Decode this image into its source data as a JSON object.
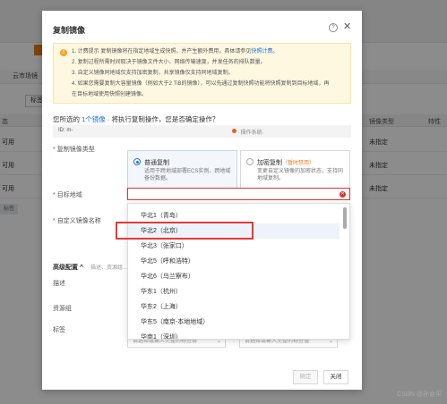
{
  "background": {
    "tabs": [
      "云市场镜",
      "标签"
    ],
    "buttons": [
      "标签"
    ],
    "table_headers": [
      "态",
      "镜像类型",
      "特性"
    ],
    "rows": [
      {
        "status": "可用",
        "type": "未指定"
      },
      {
        "status": "可用",
        "type": "未指定"
      },
      {
        "status": "可用",
        "type": "未指定"
      }
    ],
    "side_label": "标签"
  },
  "dialog": {
    "title": "复制镜像",
    "help_icon": "?",
    "close_icon": "✕",
    "notice": {
      "icon": "!",
      "line1_prefix": "1. 计费提示 复制镜像将在指定地域生成快照，并产生额外费用，具体请参见",
      "line1_link": "快照计费",
      "line1_suffix": "。",
      "line2": "2. 复制过程所需时间取决于镜像文件大小、网络传输速度，并发任务的排队数量。",
      "line3": "3. 自定义镜像同地域仅支持加密复制，共享镜像仅支持同地域复制。",
      "line4": "4. 如果您需要复制大容量镜像（例如大于2 TiB的镜像），可以先通过复制快照功能将快照复制到目标地域，再",
      "line5": "在目标地域使用快照创建镜像。"
    },
    "confirm": {
      "prefix": "您所选的 ",
      "link": "1个镜像",
      "suffix": " · 将执行复制操作，您是否确定操作？"
    },
    "image_id": "ID: m-",
    "image_id_right": "· 操作系统·",
    "copy_type_label": "复制镜像类型",
    "options": [
      {
        "title": "普通复制",
        "tag": "",
        "desc": "适用于跨地域部署ECS实例、跨地域备份数据。",
        "selected": true
      },
      {
        "title": "加密复制",
        "tag": "（暂时禁用）",
        "desc": "变更自定义镜像的加密状态，支持同地域复制。",
        "selected": false
      }
    ],
    "target_region_label": "目标地域",
    "custom_name_label": "自定义镜像名称",
    "regions": [
      "华北1（青岛）",
      "华北2（北京）",
      "华北3（张家口）",
      "华北5（呼和浩特）",
      "华北6（乌兰察布）",
      "华东1（杭州）",
      "华东2（上海）",
      "华东5（南京-本地地域）",
      "华南1（深圳）"
    ],
    "hover_index": 1,
    "advanced_label": "高级配置",
    "advanced_sub": "描述、资源组...",
    "desc_label": "描述",
    "resource_group_label": "资源组",
    "tag_label": "标签",
    "tag_key_placeholder": "请选择或输入完整的标签键",
    "tag_value_placeholder": "请选择或输入完整的标签值",
    "confirm_button": "确定",
    "close_button": "关闭"
  },
  "watermark": "CSDN @孙俞平"
}
